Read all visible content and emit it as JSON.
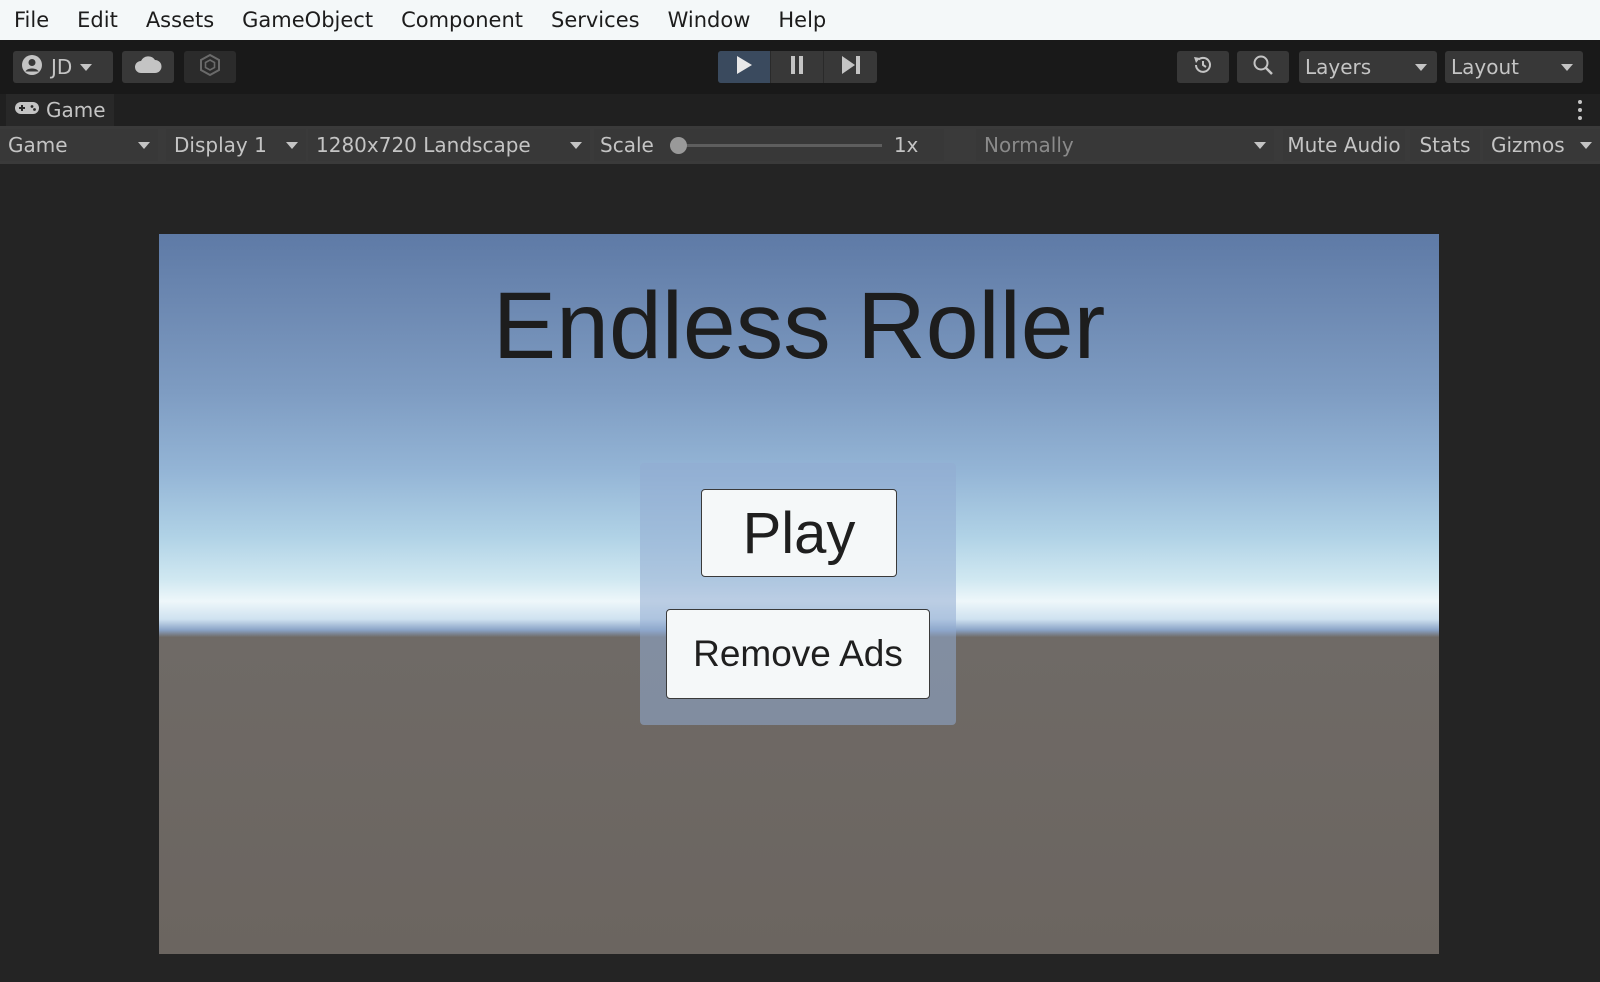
{
  "menu": {
    "items": [
      "File",
      "Edit",
      "Assets",
      "GameObject",
      "Component",
      "Services",
      "Window",
      "Help"
    ]
  },
  "toolbar": {
    "account_label": "JD",
    "layers_label": "Layers",
    "layout_label": "Layout"
  },
  "game_tab": {
    "label": "Game"
  },
  "game_toolbar": {
    "mode": "Game",
    "display": "Display 1",
    "resolution": "1280x720 Landscape",
    "scale_label": "Scale",
    "scale_value": "1x",
    "enter_play_mode": "Normally",
    "mute_audio": "Mute Audio",
    "stats": "Stats",
    "gizmos": "Gizmos"
  },
  "game_view": {
    "title": "Endless Roller",
    "play_button": "Play",
    "remove_ads_button": "Remove Ads"
  },
  "colors": {
    "menubar_bg": "#f4f8f9",
    "toolbar_bg": "#191919",
    "button_bg": "#383838",
    "viewport_bg": "#242424",
    "ground": "#6b6560",
    "sky_top": "#5e7aa6"
  }
}
